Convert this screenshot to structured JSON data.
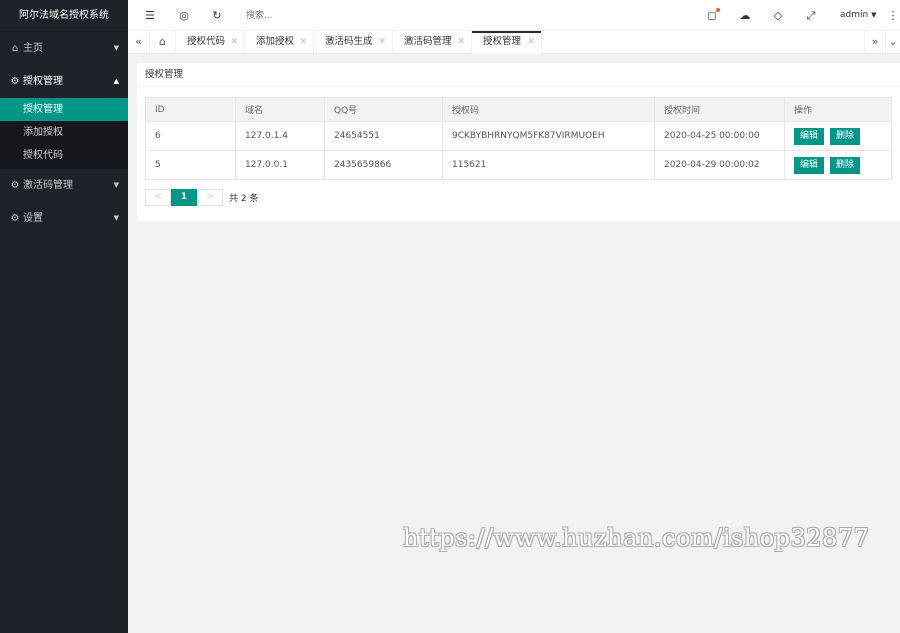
{
  "app": {
    "title": "阿尔法域名授权系统"
  },
  "sidebar": {
    "items": [
      {
        "label": "主页",
        "icon": "home-icon"
      },
      {
        "label": "授权管理",
        "icon": "gear-icon",
        "children": [
          {
            "label": "授权管理"
          },
          {
            "label": "添加授权"
          },
          {
            "label": "授权代码"
          }
        ]
      },
      {
        "label": "激活码管理",
        "icon": "gear-icon"
      },
      {
        "label": "设置",
        "icon": "settings-icon"
      }
    ]
  },
  "header": {
    "search_placeholder": "搜索...",
    "user": "admin"
  },
  "tabs": [
    {
      "label": "授权代码"
    },
    {
      "label": "添加授权"
    },
    {
      "label": "激活码生成"
    },
    {
      "label": "激活码管理"
    },
    {
      "label": "授权管理"
    }
  ],
  "card": {
    "title": "授权管理",
    "columns": [
      "ID",
      "域名",
      "QQ号",
      "授权码",
      "授权时间",
      "操作"
    ],
    "rows": [
      {
        "id": "6",
        "domain": "127.0.1.4",
        "qq": "24654551",
        "code": "9CKBYBHRNYQM5FK87VIRMUOEH",
        "time": "2020-04-25 00:00:00"
      },
      {
        "id": "5",
        "domain": "127.0.0.1",
        "qq": "2435659866",
        "code": "115621",
        "time": "2020-04-29 00:00:02"
      }
    ],
    "actions": {
      "edit": "编辑",
      "delete": "删除"
    },
    "pager": {
      "prev": "<",
      "current": "1",
      "next": ">",
      "total": "共 2 条"
    }
  },
  "watermark": "https://www.huzhan.com/ishop32877",
  "colors": {
    "accent": "#009688",
    "sidebar": "#20222a",
    "notify_dot": "#ff5722"
  }
}
